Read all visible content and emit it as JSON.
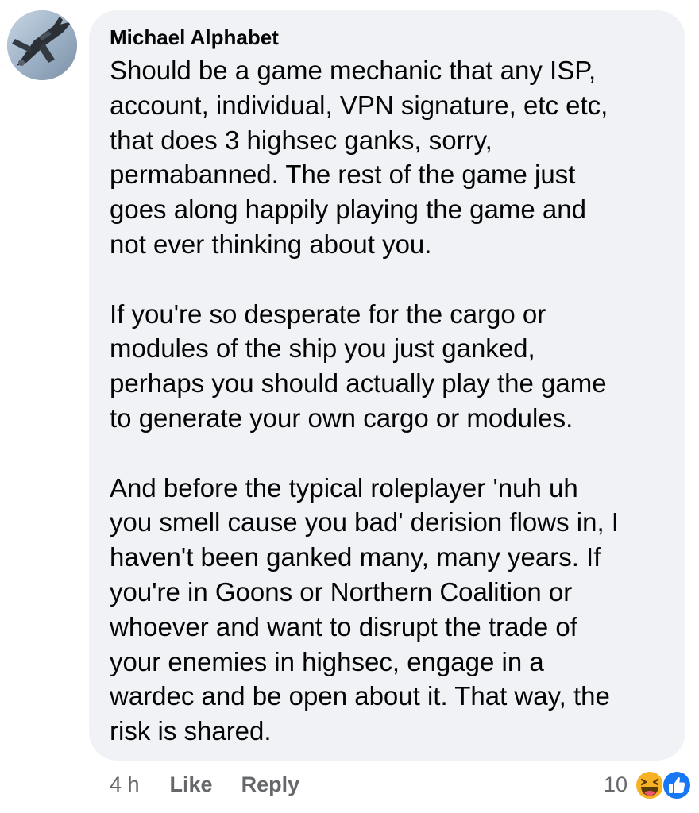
{
  "comment": {
    "author": "Michael Alphabet",
    "avatar_icon": "jet-aircraft-avatar",
    "paragraphs": [
      [
        "Should be a game mechanic that any ISP,",
        "account, individual, VPN signature, etc etc,",
        "that does 3 highsec ganks, sorry,",
        "permabanned. The rest of the game just",
        "goes along happily playing the game and",
        "not ever thinking about you."
      ],
      [
        "If you're so desperate for the cargo or",
        "modules of the ship you just ganked,",
        "perhaps you should actually play the game",
        "to generate your own cargo or modules."
      ],
      [
        "And before the typical roleplayer 'nuh uh",
        "you smell cause you bad' derision flows in, I",
        "haven't been ganked many, many years. If",
        "you're in Goons or Northern Coalition or",
        "whoever and want to disrupt the trade of",
        "your enemies in highsec, engage in a",
        "wardec and be open about it. That way, the",
        "risk is shared."
      ]
    ]
  },
  "actions": {
    "time": "4 h",
    "like_label": "Like",
    "reply_label": "Reply"
  },
  "reactions": {
    "count": "10",
    "icons": [
      "haha-reaction-icon",
      "like-reaction-icon"
    ],
    "like_color": "#1877f2",
    "haha_color": "#f7b125"
  },
  "colors": {
    "bubble_bg": "#f0f2f5",
    "text": "#050505",
    "secondary_text": "#65676b"
  }
}
